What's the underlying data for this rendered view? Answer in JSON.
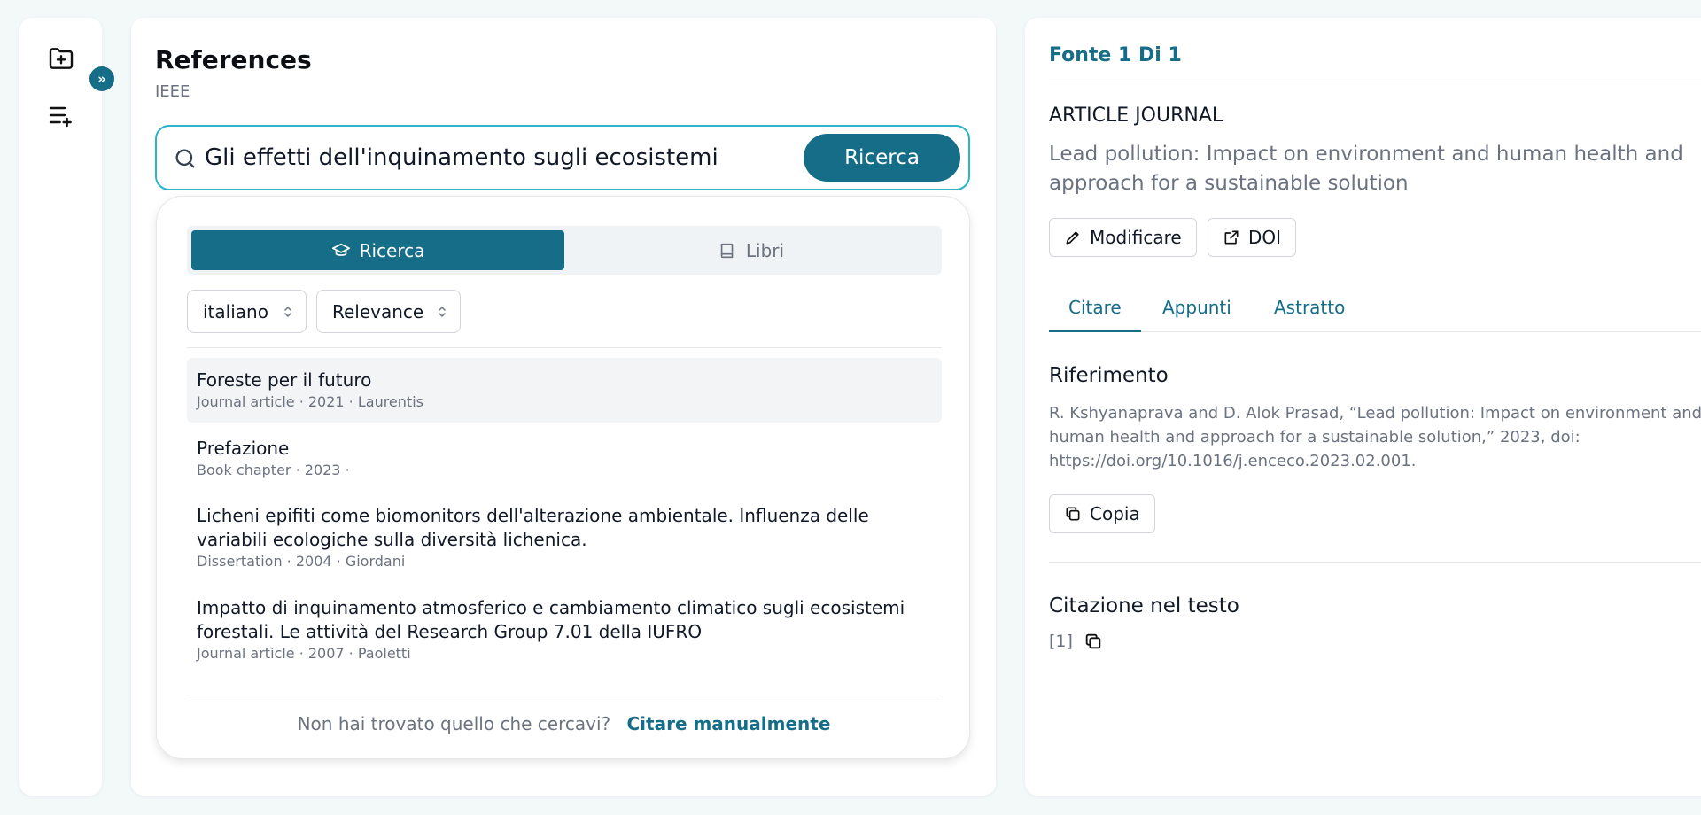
{
  "references_panel": {
    "title": "References",
    "style": "IEEE",
    "search": {
      "value": "Gli effetti dell'inquinamento sugli ecosistemi",
      "button_label": "Ricerca"
    },
    "segments": [
      {
        "label": "Ricerca",
        "icon": "graduation-cap-icon",
        "selected": true
      },
      {
        "label": "Libri",
        "icon": "book-icon",
        "selected": false
      }
    ],
    "filters": {
      "language": "italiano",
      "sort": "Relevance"
    },
    "results": [
      {
        "title": "Foreste per il futuro",
        "meta": "Journal article · 2021 · Laurentis"
      },
      {
        "title": "Prefazione",
        "meta": "Book chapter · 2023 ·"
      },
      {
        "title": "Licheni epifiti come biomonitors dell'alterazione ambientale. Influenza delle variabili ecologiche sulla diversità lichenica.",
        "meta": "Dissertation · 2004 · Giordani"
      },
      {
        "title": "Impatto di inquinamento atmosferico e cambiamento climatico sugli ecosistemi forestali. Le attività del Research Group 7.01 della IUFRO",
        "meta": "Journal article · 2007 · Paoletti"
      }
    ],
    "footer": {
      "question": "Non hai trovato quello che cercavi?",
      "link": "Citare manualmente"
    }
  },
  "rail": {
    "expand_label": "»"
  },
  "source_panel": {
    "heading": "Fonte 1 Di 1",
    "type": "ARTICLE JOURNAL",
    "title": "Lead pollution: Impact on environment and human health and approach for a sustainable solution",
    "edit_label": "Modificare",
    "doi_label": "DOI",
    "tabs": [
      "Citare",
      "Appunti",
      "Astratto"
    ],
    "reference_heading": "Riferimento",
    "reference_text": "R. Kshyanaprava and D. Alok Prasad, “Lead pollution: Impact on environment and human health and approach for a sustainable solution,” 2023, doi: https://doi.org/10.1016/j.enceco.2023.02.001.",
    "copy_label": "Copia",
    "intext_heading": "Citazione nel testo",
    "intext_value": "[1]"
  },
  "colors": {
    "accent": "#156d88",
    "search_border": "#2bb3cb",
    "background": "#f3f8f9"
  }
}
